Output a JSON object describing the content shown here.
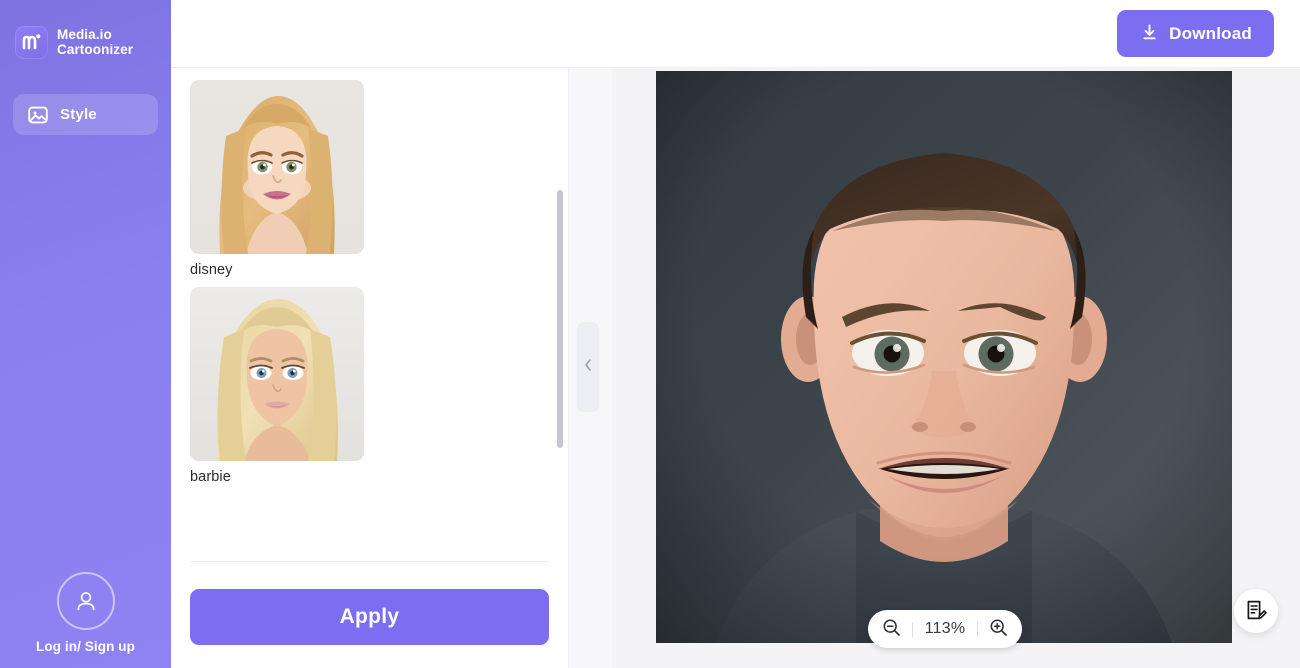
{
  "brand": {
    "logo_icon": "mediaio-logo-icon",
    "line1": "Media.io",
    "line2": "Cartoonizer"
  },
  "sidebar": {
    "items": [
      {
        "label": "Style",
        "icon": "image-icon",
        "active": true
      }
    ],
    "footer": {
      "avatar_icon": "user-avatar-icon",
      "label": "Log in/ Sign up"
    }
  },
  "topbar": {
    "download_label": "Download",
    "download_icon": "download-icon"
  },
  "style_panel": {
    "styles": [
      {
        "name": "disney"
      },
      {
        "name": "barbie"
      }
    ],
    "apply_label": "Apply"
  },
  "canvas": {
    "collapse_icon": "chevron-left-icon",
    "zoom": {
      "zoom_out_icon": "zoom-out-icon",
      "value": "113%",
      "zoom_in_icon": "zoom-in-icon"
    },
    "feedback_icon": "feedback-note-icon"
  },
  "colors": {
    "accent": "#7c6ef0",
    "sidebar": "#8a7ff0",
    "canvas_bg": "#f4f4f6"
  }
}
